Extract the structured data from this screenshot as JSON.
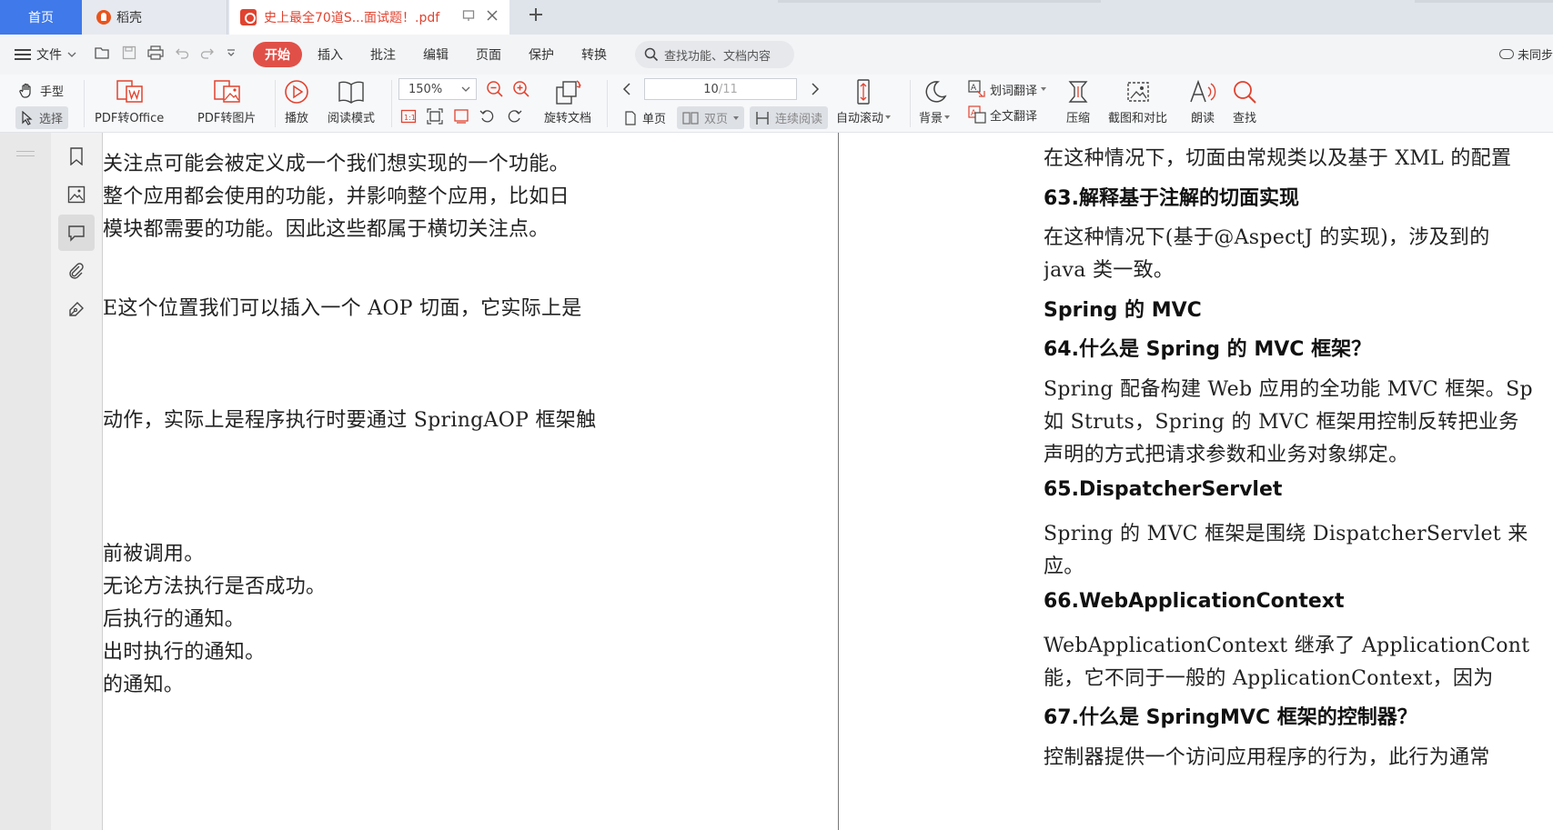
{
  "tabs": {
    "home": "首页",
    "daoke": "稻壳",
    "pdf": "史上最全70道S...面试题！.pdf"
  },
  "menu": {
    "file": "文件",
    "items": [
      "开始",
      "插入",
      "批注",
      "编辑",
      "页面",
      "保护",
      "转换"
    ],
    "search_placeholder": "查找功能、文档内容",
    "sync_status": "未同步"
  },
  "toolbar": {
    "hand": "手型",
    "select": "选择",
    "pdf_to_office": "PDF转Office",
    "pdf_to_image": "PDF转图片",
    "play": "播放",
    "reading_mode": "阅读模式",
    "zoom": "150%",
    "rotate": "旋转文档",
    "page_current": "10",
    "page_total": "/11",
    "single": "单页",
    "double": "双页",
    "continuous": "连续阅读",
    "auto_scroll": "自动滚动",
    "background": "背景",
    "word_translate": "划词翻译",
    "full_translate": "全文翻译",
    "compress": "压缩",
    "screenshot_compare": "截图和对比",
    "read_aloud": "朗读",
    "find": "查找"
  },
  "left_page": {
    "lines": [
      "关注点可能会被定义成一个我们想实现的一个功能。",
      "整个应用都会使用的功能，并影响整个应用，比如日",
      "模块都需要的功能。因此这些都属于横切关注点。",
      "E这个位置我们可以插入一个 AOP 切面，它实际上是",
      "动作，实际上是程序执行时要通过 SpringAOP 框架触",
      "前被调用。",
      "无论方法执行是否成功。",
      "后执行的通知。",
      "出时执行的通知。",
      "的通知。"
    ]
  },
  "right_page": {
    "line_1": "在这种情况下，切面由常规类以及基于 XML 的配置",
    "h63": "63.解释基于注解的切面实现",
    "p63_1": "在这种情况下(基于@AspectJ 的实现)，涉及到的",
    "p63_2": "java 类一致。",
    "h_mvc": "Spring 的 MVC",
    "h64": "64.什么是 Spring 的 MVC 框架？",
    "p64_1": "Spring 配备构建 Web 应用的全功能 MVC 框架。Sp",
    "p64_2": "如 Struts，Spring 的 MVC 框架用控制反转把业务",
    "p64_3": "声明的方式把请求参数和业务对象绑定。",
    "h65": "65.DispatcherServlet",
    "p65_1": "Spring 的 MVC 框架是围绕 DispatcherServlet 来",
    "p65_2": "应。",
    "h66": "66.WebApplicationContext",
    "p66_1": "WebApplicationContext 继承了 ApplicationCont",
    "p66_2": "能，它不同于一般的 ApplicationContext，因为",
    "h67": "67.什么是 SpringMVC 框架的控制器？",
    "p67_1": "控制器提供一个访问应用程序的行为，此行为通常"
  },
  "colors": {
    "accent_blue": "#3f79ea",
    "accent_red": "#e05048"
  }
}
